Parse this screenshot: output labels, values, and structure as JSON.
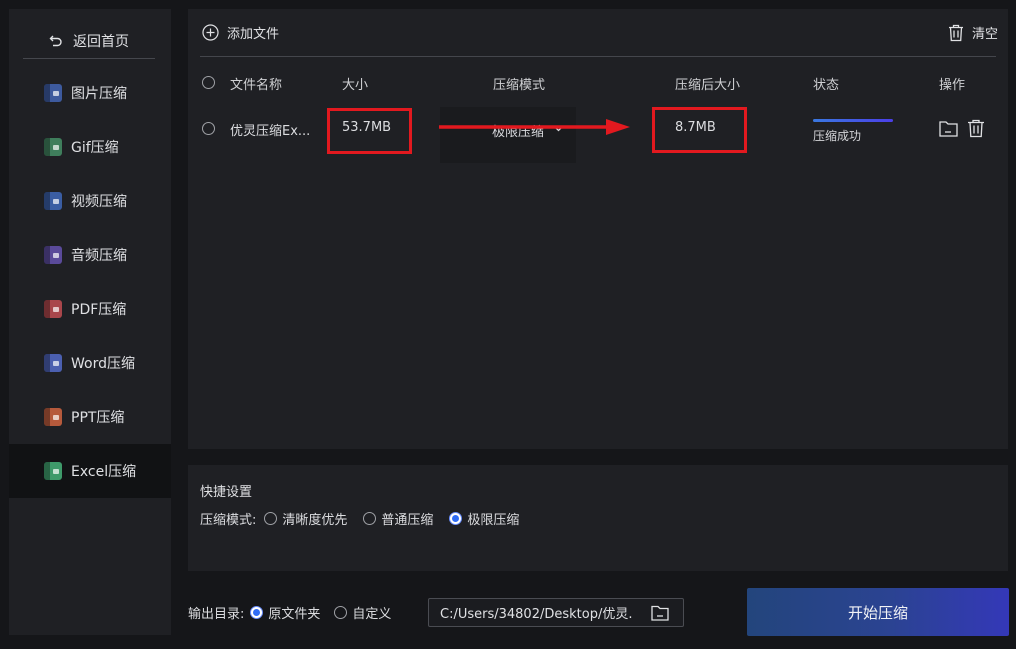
{
  "sidebar": {
    "back_label": "返回首页",
    "items": [
      {
        "label": "图片压缩",
        "icon": "image-file-icon",
        "color": "#3d5a9e",
        "active": false
      },
      {
        "label": "Gif压缩",
        "icon": "gif-file-icon",
        "color": "#3f7e5c",
        "active": false
      },
      {
        "label": "视频压缩",
        "icon": "video-file-icon",
        "color": "#3a5da3",
        "active": false
      },
      {
        "label": "音频压缩",
        "icon": "audio-file-icon",
        "color": "#5a4a9a",
        "active": false
      },
      {
        "label": "PDF压缩",
        "icon": "pdf-file-icon",
        "color": "#a9464b",
        "active": false
      },
      {
        "label": "Word压缩",
        "icon": "word-file-icon",
        "color": "#4b5fb0",
        "active": false
      },
      {
        "label": "PPT压缩",
        "icon": "ppt-file-icon",
        "color": "#b65a3c",
        "active": false
      },
      {
        "label": "Excel压缩",
        "icon": "excel-file-icon",
        "color": "#3e9a6a",
        "active": true
      }
    ]
  },
  "toolbar": {
    "add_label": "添加文件",
    "clear_label": "清空"
  },
  "table": {
    "headers": {
      "name": "文件名称",
      "size": "大小",
      "mode": "压缩模式",
      "after": "压缩后大小",
      "status": "状态",
      "ops": "操作"
    },
    "rows": [
      {
        "name": "优灵压缩Ex...",
        "size": "53.7MB",
        "mode": "极限压缩",
        "after": "8.7MB",
        "status": "压缩成功",
        "progress": 1.0
      }
    ]
  },
  "quick": {
    "title": "快捷设置",
    "mode_label": "压缩模式:",
    "options": [
      "清晰度优先",
      "普通压缩",
      "极限压缩"
    ],
    "selected": "极限压缩"
  },
  "output": {
    "label": "输出目录:",
    "options": [
      "原文件夹",
      "自定义"
    ],
    "selected": "原文件夹",
    "path": "C:/Users/34802/Desktop/优灵."
  },
  "start_label": "开始压缩",
  "colors": {
    "highlight": "#e2191f",
    "accent": "#2f6cf6"
  }
}
